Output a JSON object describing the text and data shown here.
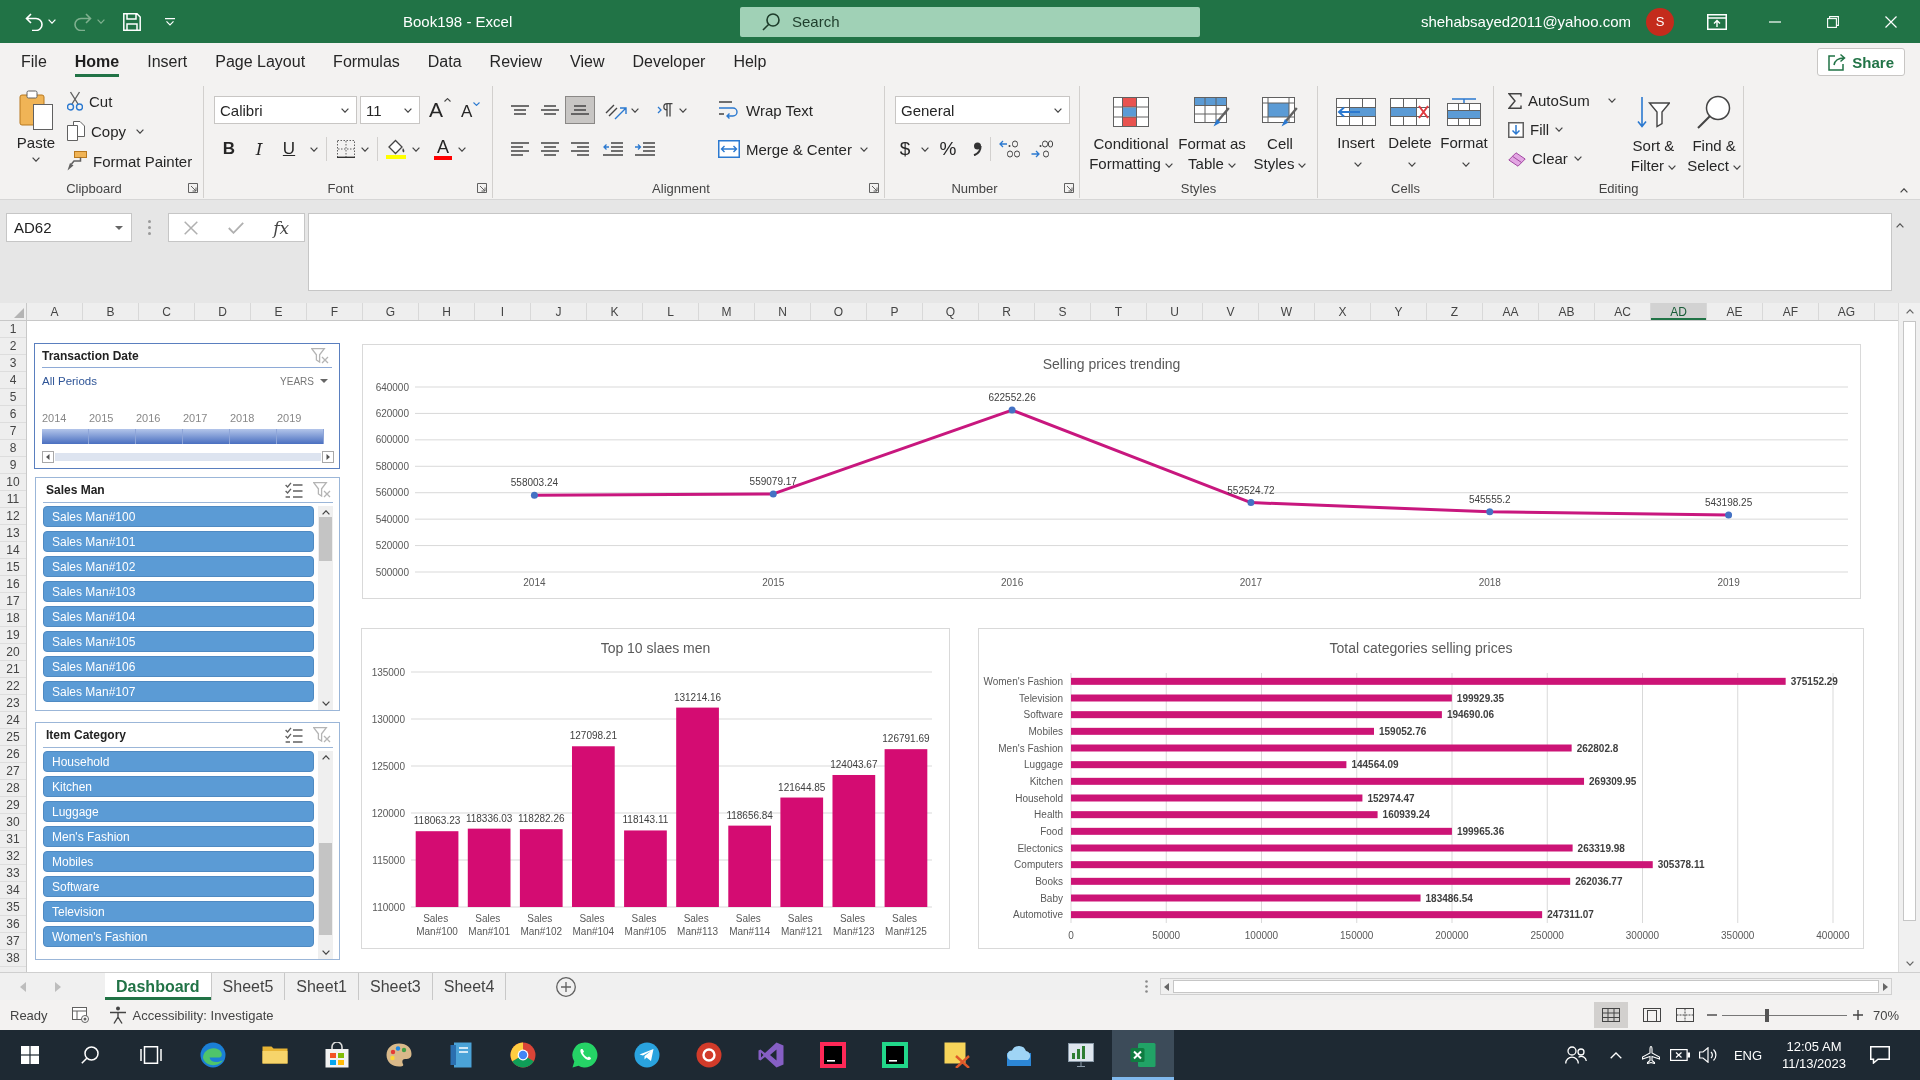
{
  "title_bar": {
    "quick_access": [
      {
        "kind": "undo",
        "disabled": false
      },
      {
        "kind": "redo",
        "disabled": true
      },
      {
        "kind": "save",
        "disabled": false
      }
    ],
    "title": "Book198 - Excel",
    "search": {
      "placeholder": "Search"
    },
    "account": "shehabsayed2011@yahoo.com",
    "avatar": "S"
  },
  "ribbon": {
    "tabs": [
      {
        "label": "File",
        "selected": false
      },
      {
        "label": "Home",
        "selected": true
      },
      {
        "label": "Insert",
        "selected": false
      },
      {
        "label": "Page Layout",
        "selected": false
      },
      {
        "label": "Formulas",
        "selected": false
      },
      {
        "label": "Data",
        "selected": false
      },
      {
        "label": "Review",
        "selected": false
      },
      {
        "label": "View",
        "selected": false
      },
      {
        "label": "Developer",
        "selected": false
      },
      {
        "label": "Help",
        "selected": false
      }
    ],
    "share": "Share",
    "groups": [
      {
        "kind": "clipboard",
        "label": "Clipboard",
        "paste": "Paste",
        "commands": [
          "Cut",
          "Copy",
          "Format Painter"
        ]
      },
      {
        "kind": "font",
        "label": "Font",
        "font_name": "Calibri",
        "font_size": "11",
        "size_buttons": [
          "A",
          "A"
        ],
        "styles": [
          "B",
          "I",
          "U"
        ],
        "font_color": "A"
      },
      {
        "kind": "alignment",
        "label": "Alignment",
        "vertical": [
          {
            "selected": false
          },
          {
            "selected": false
          },
          {
            "selected": true
          }
        ],
        "commands": [
          "Wrap Text",
          "Merge & Center"
        ]
      },
      {
        "kind": "number",
        "label": "Number",
        "format": "General",
        "symbols": [
          "$",
          "%"
        ]
      },
      {
        "kind": "styles",
        "label": "Styles",
        "buttons": [
          [
            "Conditional",
            "Formatting"
          ],
          [
            "Format as",
            "Table"
          ],
          [
            "Cell",
            "Styles"
          ]
        ]
      },
      {
        "kind": "cells",
        "label": "Cells",
        "buttons": [
          "Insert",
          "Delete",
          "Format"
        ]
      },
      {
        "kind": "editing",
        "label": "Editing",
        "commands": [
          "AutoSum",
          "Fill",
          "Clear"
        ],
        "buttons": [
          [
            "Sort &",
            "Filter"
          ],
          [
            "Find &",
            "Select"
          ]
        ]
      }
    ]
  },
  "formula_bar": {
    "name_box": "AD62",
    "buttons": [
      {
        "kind": "cancel",
        "disabled": true
      },
      {
        "kind": "enter",
        "disabled": true
      }
    ],
    "function": "fx"
  },
  "sheet": {
    "columns": [
      {
        "label": "A",
        "selected": false
      },
      {
        "label": "B",
        "selected": false
      },
      {
        "label": "C",
        "selected": false
      },
      {
        "label": "D",
        "selected": false
      },
      {
        "label": "E",
        "selected": false
      },
      {
        "label": "F",
        "selected": false
      },
      {
        "label": "G",
        "selected": false
      },
      {
        "label": "H",
        "selected": false
      },
      {
        "label": "I",
        "selected": false
      },
      {
        "label": "J",
        "selected": false
      },
      {
        "label": "K",
        "selected": false
      },
      {
        "label": "L",
        "selected": false
      },
      {
        "label": "M",
        "selected": false
      },
      {
        "label": "N",
        "selected": false
      },
      {
        "label": "O",
        "selected": false
      },
      {
        "label": "P",
        "selected": false
      },
      {
        "label": "Q",
        "selected": false
      },
      {
        "label": "R",
        "selected": false
      },
      {
        "label": "S",
        "selected": false
      },
      {
        "label": "T",
        "selected": false
      },
      {
        "label": "U",
        "selected": false
      },
      {
        "label": "V",
        "selected": false
      },
      {
        "label": "W",
        "selected": false
      },
      {
        "label": "X",
        "selected": false
      },
      {
        "label": "Y",
        "selected": false
      },
      {
        "label": "Z",
        "selected": false
      },
      {
        "label": "AA",
        "selected": false
      },
      {
        "label": "AB",
        "selected": false
      },
      {
        "label": "AC",
        "selected": false
      },
      {
        "label": "AD",
        "selected": true
      },
      {
        "label": "AE",
        "selected": false
      },
      {
        "label": "AF",
        "selected": false
      },
      {
        "label": "AG",
        "selected": false
      }
    ],
    "rows": [
      "1",
      "2",
      "3",
      "4",
      "5",
      "6",
      "7",
      "8",
      "9",
      "10",
      "11",
      "12",
      "13",
      "14",
      "15",
      "16",
      "17",
      "18",
      "19",
      "20",
      "21",
      "22",
      "23",
      "24",
      "25",
      "26",
      "27",
      "28",
      "29",
      "30",
      "31",
      "32",
      "33",
      "34",
      "35",
      "36",
      "37",
      "38"
    ]
  },
  "dashboard": {
    "timeline": {
      "title": "Transaction Date",
      "clear_filter_disabled": true,
      "filter": "All Periods",
      "time_level": "YEARS",
      "periods": [
        {
          "label": "2014",
          "selected": true
        },
        {
          "label": "2015",
          "selected": true
        },
        {
          "label": "2016",
          "selected": true
        },
        {
          "label": "2017",
          "selected": true
        },
        {
          "label": "2018",
          "selected": true
        },
        {
          "label": "2019",
          "selected": true
        }
      ]
    },
    "slicers": [
      {
        "title": "Sales Man",
        "clear_filter_disabled": true,
        "items": [
          {
            "label": "Sales Man#100",
            "selected": true
          },
          {
            "label": "Sales Man#101",
            "selected": true
          },
          {
            "label": "Sales Man#102",
            "selected": true
          },
          {
            "label": "Sales Man#103",
            "selected": true
          },
          {
            "label": "Sales Man#104",
            "selected": true
          },
          {
            "label": "Sales Man#105",
            "selected": true
          },
          {
            "label": "Sales Man#106",
            "selected": true
          },
          {
            "label": "Sales Man#107",
            "selected": true
          }
        ]
      },
      {
        "title": "Item Category",
        "clear_filter_disabled": true,
        "items": [
          {
            "label": "Household",
            "selected": true
          },
          {
            "label": "Kitchen",
            "selected": true
          },
          {
            "label": "Luggage",
            "selected": true
          },
          {
            "label": "Men's Fashion",
            "selected": true
          },
          {
            "label": "Mobiles",
            "selected": true
          },
          {
            "label": "Software",
            "selected": true
          },
          {
            "label": "Television",
            "selected": true
          },
          {
            "label": "Women's Fashion",
            "selected": true
          }
        ]
      }
    ],
    "charts": [
      {
        "chart_data": [
          {
            "type": "line",
            "title": "Selling prices trending",
            "categories": [
              "2014",
              "2015",
              "2016",
              "2017",
              "2018",
              "2019"
            ],
            "values": [
              558003.24,
              559079.17,
              622552.26,
              552524.72,
              545555.2,
              543198.25
            ],
            "color": "#c8177e",
            "marker": "circle",
            "data_labels": true,
            "grid": true,
            "ylim": [
              500000,
              640000
            ],
            "yticks": [
              500000,
              520000,
              540000,
              560000,
              580000,
              600000,
              620000,
              640000
            ]
          }
        ]
      },
      {
        "chart_data": [
          {
            "type": "bar",
            "title": "Top 10 slaes men",
            "categories": [
              "Sales Man#100",
              "Sales Man#101",
              "Sales Man#102",
              "Sales Man#104",
              "Sales Man#105",
              "Sales Man#113",
              "Sales Man#114",
              "Sales Man#121",
              "Sales Man#123",
              "Sales Man#125"
            ],
            "values": [
              118063.23,
              118336.03,
              118282.26,
              127098.21,
              118143.11,
              131214.16,
              118656.84,
              121644.85,
              124043.67,
              126791.69
            ],
            "color": "#d40c72",
            "data_labels": true,
            "grid": true,
            "ylim": [
              110000,
              135000
            ],
            "yticks": [
              110000,
              115000,
              120000,
              125000,
              130000,
              135000
            ]
          }
        ]
      },
      {
        "chart_data": [
          {
            "type": "bar",
            "orientation": "horizontal",
            "title": "Total categories selling prices",
            "categories": [
              "Women's Fashion",
              "Television",
              "Software",
              "Mobiles",
              "Men's Fashion",
              "Luggage",
              "Kitchen",
              "Household",
              "Health",
              "Food",
              "Electonics",
              "Computers",
              "Books",
              "Baby",
              "Automotive"
            ],
            "values": [
              375152.29,
              199929.35,
              194690.06,
              159052.76,
              262802.8,
              144564.09,
              269309.95,
              152974.47,
              160939.24,
              199965.36,
              263319.98,
              305378.11,
              262036.77,
              183486.54,
              247311.07
            ],
            "color": "#cc1476",
            "data_labels": true,
            "grid": true,
            "xlim": [
              0,
              400000
            ],
            "xticks": [
              0,
              50000,
              100000,
              150000,
              200000,
              250000,
              300000,
              350000,
              400000
            ]
          }
        ]
      }
    ]
  },
  "sheet_tabs": {
    "nav": [
      {
        "kind": "previous",
        "disabled": true
      },
      {
        "kind": "next",
        "disabled": true
      }
    ],
    "tabs": [
      {
        "label": "Dashboard",
        "selected": true
      },
      {
        "label": "Sheet5",
        "selected": false
      },
      {
        "label": "Sheet1",
        "selected": false
      },
      {
        "label": "Sheet3",
        "selected": false
      },
      {
        "label": "Sheet4",
        "selected": false
      }
    ]
  },
  "status_bar": {
    "mode": "Ready",
    "accessibility": "Accessibility: Investigate",
    "views": [
      {
        "kind": "normal",
        "selected": true
      },
      {
        "kind": "page_layout",
        "selected": false
      },
      {
        "kind": "page_break",
        "selected": false
      }
    ],
    "zoom": {
      "level": 0.36,
      "reading": "70%"
    }
  },
  "taskbar": {
    "apps": [
      {
        "kind": "edge",
        "selected": false
      },
      {
        "kind": "folder",
        "selected": false
      },
      {
        "kind": "store",
        "selected": false
      },
      {
        "kind": "palette",
        "selected": false
      },
      {
        "kind": "notebook",
        "selected": false
      },
      {
        "kind": "chrome",
        "selected": false
      },
      {
        "kind": "whatsapp",
        "selected": false
      },
      {
        "kind": "telegram",
        "selected": false
      },
      {
        "kind": "roundapp",
        "selected": false
      },
      {
        "kind": "studio",
        "selected": false
      },
      {
        "kind": "ij",
        "selected": false
      },
      {
        "kind": "pc",
        "selected": false
      },
      {
        "kind": "note",
        "selected": false
      },
      {
        "kind": "cloud",
        "selected": false
      },
      {
        "kind": "monitor",
        "selected": false
      },
      {
        "kind": "excel",
        "selected": true
      }
    ],
    "language": "ENG",
    "time": "12:05 AM",
    "date": "11/13/2023"
  }
}
